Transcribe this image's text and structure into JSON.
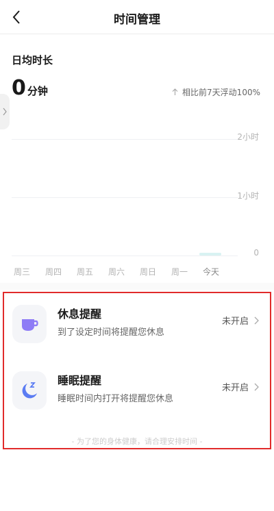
{
  "header": {
    "title": "时间管理",
    "back_icon": "chevron-left-icon"
  },
  "summary": {
    "title": "日均时长",
    "value": "0",
    "unit": "分钟",
    "compare_text": "相比前7天浮动100%",
    "compare_icon": "arrow-up-icon"
  },
  "side_tab": {
    "icon": "chevron-right-icon"
  },
  "chart_data": {
    "type": "bar",
    "categories": [
      "周三",
      "周四",
      "周五",
      "周六",
      "周日",
      "周一",
      "今天"
    ],
    "values": [
      0,
      0,
      0,
      0,
      0,
      0,
      0
    ],
    "y_ticks": [
      "2小时",
      "1小时",
      "0"
    ],
    "ylim": [
      0,
      2
    ],
    "grid": true
  },
  "reminders": [
    {
      "title": "休息提醒",
      "desc": "到了设定时间将提醒您休息",
      "status": "未开启",
      "icon": "cup-icon",
      "icon_color": "#8E7CF6"
    },
    {
      "title": "睡眠提醒",
      "desc": "睡眠时间内打开将提醒您休息",
      "status": "未开启",
      "icon": "moon-icon",
      "icon_color": "#5B7CF3"
    }
  ],
  "footer_note": "- 为了您的身体健康，请合理安排时间 -",
  "colors": {
    "highlight_border": "#E12A2A",
    "today_bar": "#D8F2F2"
  }
}
